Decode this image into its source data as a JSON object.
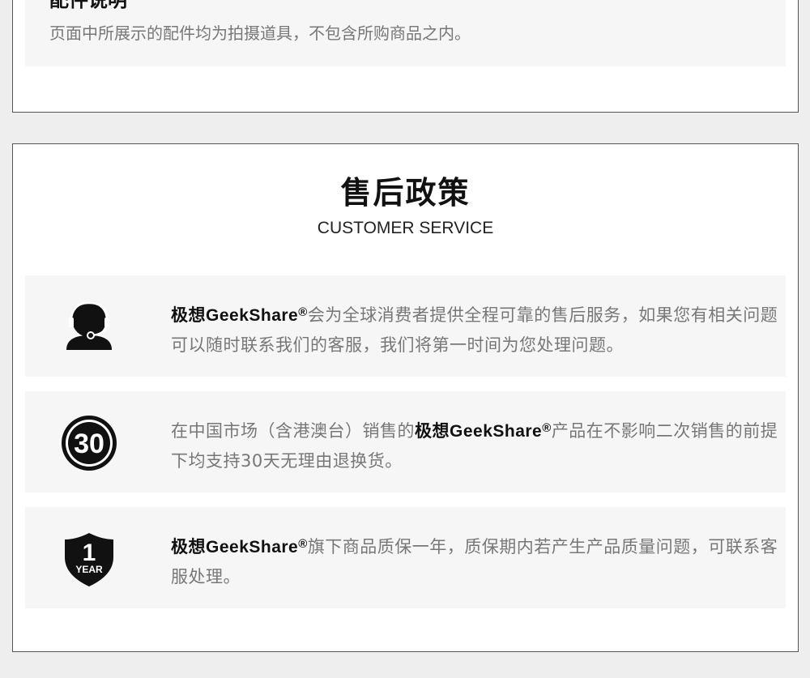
{
  "accessories": {
    "title": "配件说明",
    "text": "页面中所展示的配件均为拍摄道具，不包含所购商品之内。"
  },
  "after_sales": {
    "title": "售后政策",
    "subtitle": "CUSTOMER SERVICE",
    "brand": "极想GeekShare",
    "reg": "®",
    "rows": [
      {
        "icon": "customer-service-icon",
        "after": "会为全球消费者提供全程可靠的售后服务，如果您有相关问题可以随时联系我们的客服，我们将第一时间为您处理问题。"
      },
      {
        "icon": "30-days-icon",
        "icon_text": "30",
        "before": "在中国市场（含港澳台）销售的",
        "after": "产品在不影响二次销售的前提下均支持30天无理由退换货。"
      },
      {
        "icon": "one-year-warranty-shield-icon",
        "icon_number": "1",
        "icon_label": "YEAR",
        "after": "旗下商品质保一年，质保期内若产生产品质量问题，可联系客服处理。"
      }
    ]
  }
}
